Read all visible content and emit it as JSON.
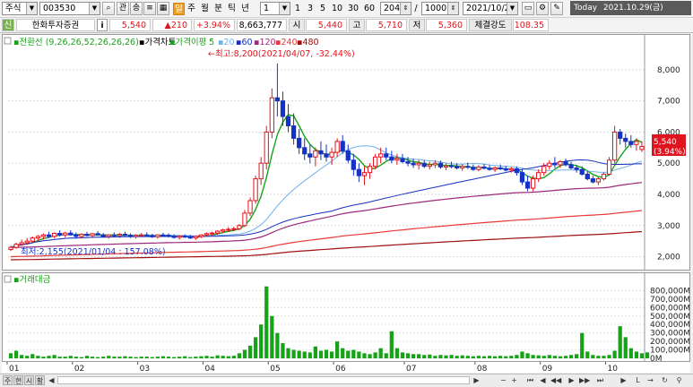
{
  "toolbar": {
    "market": "주식",
    "code": "003530",
    "btn_gwan": "관",
    "btn_sam": "송",
    "list_icon": "list-icon",
    "period_il": "일",
    "period_ju": "주",
    "period_wol": "월",
    "period_bun": "분",
    "period_tick": "틱",
    "period_nyeon": "년",
    "interval": "1",
    "n1": "1",
    "n3": "3",
    "n5": "5",
    "n10": "10",
    "n30": "30",
    "n60": "60",
    "count": "204",
    "slash": "/",
    "max": "1000",
    "date": "2021/10/29",
    "today_label": "Today",
    "today_date": "2021.10.29(금)"
  },
  "stock": {
    "name": "한화투자증권",
    "info": "i",
    "price": "5,540",
    "change": "▲210",
    "change_pct": "+3.94%",
    "volume": "8,663,777",
    "open_label": "시",
    "open": "5,440",
    "high_label": "고",
    "high": "5,710",
    "low_label": "저",
    "low": "5,360",
    "strength_label": "체결강도",
    "strength": "108.35",
    "credit_label": "신"
  },
  "legend": {
    "conv": "전환선 (9,26,26,52,26,26,26)",
    "price_chart": "가격차트",
    "ma_label": "가격이평",
    "ma5": "5",
    "ma20": "20",
    "ma60": "60",
    "ma120": "120",
    "ma240": "240",
    "ma480": "480",
    "high_note": "←최고:8,200(2021/04/07, -32.44%)",
    "low_note": "최저:2,155(2021/01/04 : 157.08%)",
    "vol_title": "거래대금"
  },
  "price_axis": [
    "8,000",
    "7,000",
    "6,000",
    "5,000",
    "4,000",
    "3,000",
    "2,000"
  ],
  "price_tag": {
    "price": "5,540",
    "pct": "(3.94%)"
  },
  "vol_axis": [
    "800,000M",
    "700,000M",
    "600,000M",
    "500,000M",
    "400,000M",
    "300,000M",
    "200,000M",
    "100,000M",
    "0M"
  ],
  "months": [
    "01",
    "02",
    "03",
    "04",
    "05",
    "06",
    "07",
    "08",
    "09",
    "10"
  ],
  "bottom": {
    "tab1": "주",
    "tab2": "현",
    "tab3": "시",
    "tab4": "황"
  },
  "colors": {
    "up": "#e0141e",
    "down": "#1432c8",
    "ma5": "#17a317",
    "ma20": "#6fb2ea",
    "ma60": "#1a2fbf",
    "ma120": "#9c2a7a",
    "ma240": "#e83a3a",
    "ma480": "#a01010"
  },
  "chart_data": {
    "type": "candlestick",
    "price_range": [
      1700,
      8600
    ],
    "daily_ohlc": [
      [
        2230,
        2350,
        2180,
        2300
      ],
      [
        2300,
        2450,
        2250,
        2400
      ],
      [
        2400,
        2550,
        2350,
        2450
      ],
      [
        2450,
        2600,
        2380,
        2500
      ],
      [
        2500,
        2650,
        2450,
        2600
      ],
      [
        2600,
        2700,
        2500,
        2650
      ],
      [
        2650,
        2750,
        2550,
        2700
      ],
      [
        2700,
        2800,
        2600,
        2650
      ],
      [
        2650,
        2780,
        2600,
        2750
      ],
      [
        2750,
        2850,
        2650,
        2700
      ],
      [
        2700,
        2800,
        2620,
        2760
      ],
      [
        2760,
        2850,
        2680,
        2700
      ],
      [
        2700,
        2780,
        2600,
        2650
      ],
      [
        2650,
        2750,
        2580,
        2720
      ],
      [
        2720,
        2800,
        2650,
        2680
      ],
      [
        2680,
        2760,
        2600,
        2740
      ],
      [
        2740,
        2820,
        2680,
        2700
      ],
      [
        2700,
        2760,
        2620,
        2650
      ],
      [
        2650,
        2720,
        2580,
        2700
      ],
      [
        2700,
        2780,
        2640,
        2680
      ],
      [
        2680,
        2760,
        2600,
        2720
      ],
      [
        2720,
        2800,
        2660,
        2690
      ],
      [
        2690,
        2750,
        2600,
        2650
      ],
      [
        2650,
        2720,
        2580,
        2690
      ],
      [
        2690,
        2760,
        2630,
        2700
      ],
      [
        2700,
        2780,
        2640,
        2680
      ],
      [
        2680,
        2740,
        2600,
        2640
      ],
      [
        2640,
        2720,
        2580,
        2700
      ],
      [
        2700,
        2770,
        2640,
        2690
      ],
      [
        2690,
        2750,
        2620,
        2660
      ],
      [
        2660,
        2720,
        2580,
        2620
      ],
      [
        2620,
        2690,
        2550,
        2660
      ],
      [
        2660,
        2720,
        2600,
        2640
      ],
      [
        2640,
        2700,
        2570,
        2600
      ],
      [
        2600,
        2680,
        2540,
        2650
      ],
      [
        2650,
        2720,
        2600,
        2700
      ],
      [
        2700,
        2780,
        2650,
        2740
      ],
      [
        2740,
        2800,
        2680,
        2760
      ],
      [
        2760,
        2850,
        2700,
        2820
      ],
      [
        2820,
        2900,
        2760,
        2860
      ],
      [
        2860,
        2950,
        2800,
        2880
      ],
      [
        2880,
        2960,
        2820,
        2900
      ],
      [
        2900,
        3050,
        2850,
        3000
      ],
      [
        3000,
        3500,
        2950,
        3400
      ],
      [
        3400,
        3900,
        3300,
        3800
      ],
      [
        3800,
        4600,
        3700,
        4500
      ],
      [
        4500,
        5200,
        4300,
        5000
      ],
      [
        5000,
        6200,
        4800,
        6000
      ],
      [
        6000,
        7400,
        5800,
        7100
      ],
      [
        7100,
        8200,
        6500,
        7000
      ],
      [
        7000,
        7300,
        6200,
        6500
      ],
      [
        6500,
        6900,
        6000,
        6200
      ],
      [
        6200,
        6600,
        5600,
        5800
      ],
      [
        5800,
        6100,
        5300,
        5500
      ],
      [
        5500,
        5800,
        5100,
        5300
      ],
      [
        5300,
        5600,
        5000,
        5200
      ],
      [
        5200,
        5500,
        4900,
        5400
      ],
      [
        5400,
        5700,
        5100,
        5300
      ],
      [
        5300,
        5600,
        5050,
        5200
      ],
      [
        5200,
        5500,
        4950,
        5350
      ],
      [
        5350,
        5800,
        5200,
        5700
      ],
      [
        5700,
        5900,
        5300,
        5400
      ],
      [
        5400,
        5600,
        5000,
        5100
      ],
      [
        5100,
        5300,
        4600,
        4800
      ],
      [
        4800,
        5000,
        4400,
        4600
      ],
      [
        4600,
        4900,
        4300,
        4700
      ],
      [
        4700,
        5000,
        4500,
        4900
      ],
      [
        4900,
        5300,
        4800,
        5200
      ],
      [
        5200,
        5500,
        5000,
        5300
      ],
      [
        5300,
        5500,
        5100,
        5200
      ],
      [
        5200,
        5400,
        5000,
        5100
      ],
      [
        5100,
        5300,
        4950,
        5150
      ],
      [
        5150,
        5300,
        5000,
        5050
      ],
      [
        5050,
        5200,
        4900,
        5000
      ],
      [
        5000,
        5150,
        4850,
        4950
      ],
      [
        4950,
        5100,
        4800,
        5000
      ],
      [
        5000,
        5100,
        4850,
        4900
      ],
      [
        4900,
        5050,
        4800,
        4950
      ],
      [
        4950,
        5100,
        4850,
        5000
      ],
      [
        5000,
        5080,
        4820,
        4880
      ],
      [
        4880,
        5000,
        4780,
        4920
      ],
      [
        4920,
        5050,
        4840,
        4900
      ],
      [
        4900,
        5000,
        4800,
        4850
      ],
      [
        4850,
        4980,
        4760,
        4900
      ],
      [
        4900,
        5020,
        4820,
        4870
      ],
      [
        4870,
        4960,
        4760,
        4800
      ],
      [
        4800,
        4940,
        4740,
        4880
      ],
      [
        4880,
        4980,
        4800,
        4840
      ],
      [
        4840,
        4940,
        4760,
        4800
      ],
      [
        4800,
        4900,
        4720,
        4850
      ],
      [
        4850,
        4960,
        4780,
        4820
      ],
      [
        4820,
        4920,
        4740,
        4780
      ],
      [
        4780,
        4880,
        4700,
        4820
      ],
      [
        4820,
        4900,
        4600,
        4700
      ],
      [
        4700,
        4800,
        4300,
        4400
      ],
      [
        4400,
        4600,
        4100,
        4200
      ],
      [
        4200,
        4600,
        4100,
        4500
      ],
      [
        4500,
        4800,
        4400,
        4700
      ],
      [
        4700,
        5000,
        4600,
        4900
      ],
      [
        4900,
        5100,
        4800,
        5000
      ],
      [
        5000,
        5200,
        4850,
        4950
      ],
      [
        4950,
        5100,
        4850,
        5050
      ],
      [
        5050,
        5150,
        4900,
        4950
      ],
      [
        4950,
        5050,
        4800,
        4850
      ],
      [
        4850,
        4950,
        4700,
        4800
      ],
      [
        4800,
        4900,
        4600,
        4650
      ],
      [
        4650,
        4750,
        4450,
        4500
      ],
      [
        4500,
        4600,
        4350,
        4400
      ],
      [
        4400,
        4550,
        4300,
        4500
      ],
      [
        4500,
        4700,
        4450,
        4650
      ],
      [
        4650,
        5200,
        4600,
        5100
      ],
      [
        5100,
        6200,
        5000,
        6000
      ],
      [
        6000,
        6100,
        5600,
        5800
      ],
      [
        5800,
        5950,
        5500,
        5700
      ],
      [
        5700,
        5900,
        5500,
        5600
      ],
      [
        5600,
        5800,
        5400,
        5700
      ],
      [
        5440,
        5710,
        5360,
        5540
      ]
    ],
    "volume_trade_value_M": [
      60000,
      90000,
      40000,
      30000,
      50000,
      30000,
      20000,
      30000,
      40000,
      20000,
      20000,
      30000,
      20000,
      15000,
      30000,
      20000,
      15000,
      20000,
      30000,
      20000,
      20000,
      25000,
      20000,
      15000,
      20000,
      20000,
      15000,
      20000,
      25000,
      20000,
      15000,
      20000,
      25000,
      15000,
      20000,
      25000,
      30000,
      20000,
      35000,
      30000,
      25000,
      30000,
      60000,
      100000,
      150000,
      250000,
      400000,
      850000,
      500000,
      300000,
      180000,
      120000,
      100000,
      90000,
      80000,
      70000,
      140000,
      90000,
      100000,
      80000,
      200000,
      120000,
      90000,
      100000,
      80000,
      60000,
      50000,
      70000,
      120000,
      60000,
      320000,
      120000,
      70000,
      60000,
      50000,
      50000,
      40000,
      45000,
      30000,
      40000,
      35000,
      40000,
      30000,
      35000,
      30000,
      25000,
      30000,
      25000,
      30000,
      25000,
      30000,
      25000,
      30000,
      40000,
      80000,
      60000,
      40000,
      35000,
      30000,
      40000,
      30000,
      25000,
      30000,
      40000,
      50000,
      300000,
      80000,
      40000,
      30000,
      30000,
      40000,
      90000,
      380000,
      250000,
      120000,
      80000,
      60000,
      70000
    ]
  }
}
